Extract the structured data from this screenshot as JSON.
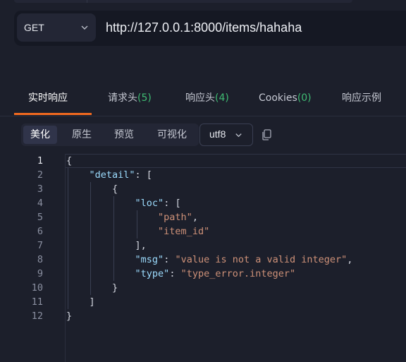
{
  "request": {
    "method": "GET",
    "url": "http://127.0.0.1:8000/items/hahaha"
  },
  "tabs": [
    {
      "label": "实时响应"
    },
    {
      "label": "请求头",
      "count": "(5)"
    },
    {
      "label": "响应头",
      "count": "(4)"
    },
    {
      "label": "Cookies",
      "count": "(0)"
    },
    {
      "label": "响应示例"
    }
  ],
  "view_modes": [
    "美化",
    "原生",
    "预览",
    "可视化"
  ],
  "encoding": "utf8",
  "colors": {
    "accent": "#f26a1f",
    "count": "#3fbb73",
    "key": "#9cdcfe",
    "string": "#ce9178"
  },
  "icons": {
    "copy": "copy-icon",
    "dropdown": "chevron-down-icon"
  },
  "active_line": 1,
  "response_lines": [
    {
      "n": "1",
      "indent": "",
      "parts": [
        [
          "p",
          "{"
        ]
      ]
    },
    {
      "n": "2",
      "indent": "    ",
      "parts": [
        [
          "k",
          "\"detail\""
        ],
        [
          "p",
          ": ["
        ]
      ]
    },
    {
      "n": "3",
      "indent": "        ",
      "parts": [
        [
          "p",
          "{"
        ]
      ]
    },
    {
      "n": "4",
      "indent": "            ",
      "parts": [
        [
          "k",
          "\"loc\""
        ],
        [
          "p",
          ": ["
        ]
      ]
    },
    {
      "n": "5",
      "indent": "                ",
      "parts": [
        [
          "s",
          "\"path\""
        ],
        [
          "p",
          ","
        ]
      ]
    },
    {
      "n": "6",
      "indent": "                ",
      "parts": [
        [
          "s",
          "\"item_id\""
        ]
      ]
    },
    {
      "n": "7",
      "indent": "            ",
      "parts": [
        [
          "p",
          "],"
        ]
      ]
    },
    {
      "n": "8",
      "indent": "            ",
      "parts": [
        [
          "k",
          "\"msg\""
        ],
        [
          "p",
          ": "
        ],
        [
          "s",
          "\"value is not a valid integer\""
        ],
        [
          "p",
          ","
        ]
      ]
    },
    {
      "n": "9",
      "indent": "            ",
      "parts": [
        [
          "k",
          "\"type\""
        ],
        [
          "p",
          ": "
        ],
        [
          "s",
          "\"type_error.integer\""
        ]
      ]
    },
    {
      "n": "10",
      "indent": "        ",
      "parts": [
        [
          "p",
          "}"
        ]
      ]
    },
    {
      "n": "11",
      "indent": "    ",
      "parts": [
        [
          "p",
          "]"
        ]
      ]
    },
    {
      "n": "12",
      "indent": "",
      "parts": [
        [
          "p",
          "}"
        ]
      ]
    }
  ]
}
